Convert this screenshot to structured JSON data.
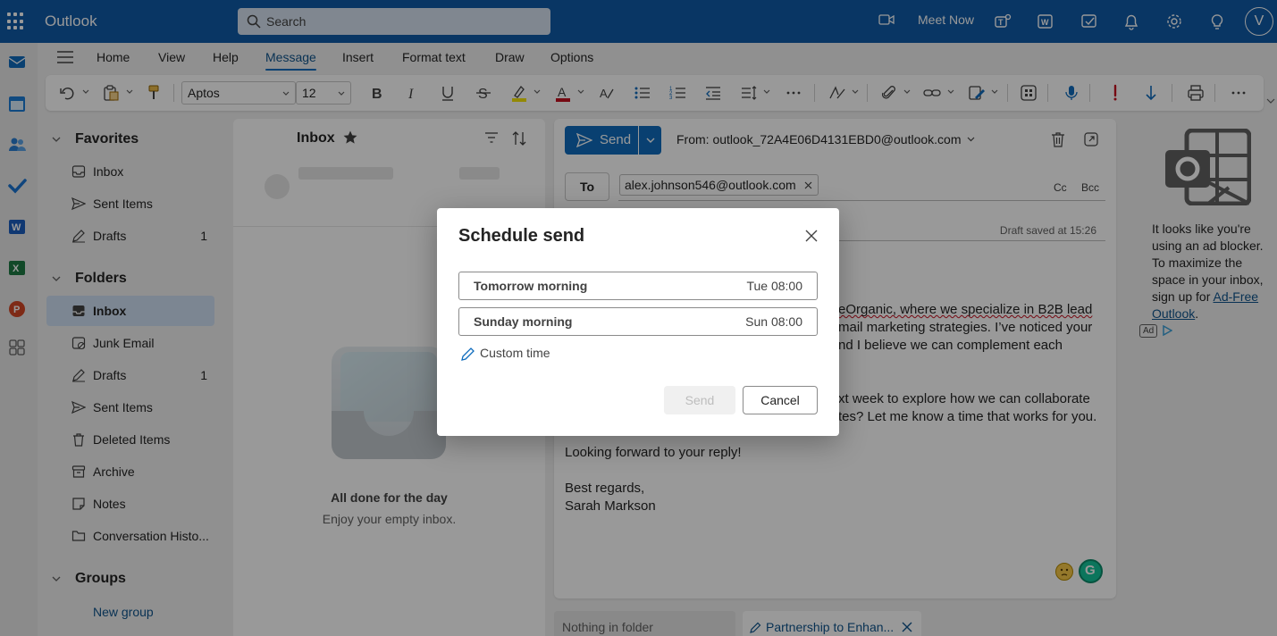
{
  "topbar": {
    "app_title": "Outlook",
    "search_placeholder": "Search",
    "meet_now": "Meet Now",
    "avatar_initial": "V"
  },
  "ribbon": {
    "tabs": [
      "Home",
      "View",
      "Help",
      "Message",
      "Insert",
      "Format text",
      "Draw",
      "Options"
    ],
    "active_tab": "Message",
    "font_name": "Aptos",
    "font_size": "12"
  },
  "folders": {
    "favorites_label": "Favorites",
    "favorites": [
      {
        "label": "Inbox",
        "count": "",
        "icon": "inbox-icon"
      },
      {
        "label": "Sent Items",
        "count": "",
        "icon": "send-icon"
      },
      {
        "label": "Drafts",
        "count": "1",
        "icon": "pencil-icon"
      }
    ],
    "folders_label": "Folders",
    "items": [
      {
        "label": "Inbox",
        "count": "",
        "icon": "inbox-icon"
      },
      {
        "label": "Junk Email",
        "count": "",
        "icon": "junk-icon"
      },
      {
        "label": "Drafts",
        "count": "1",
        "icon": "pencil-icon"
      },
      {
        "label": "Sent Items",
        "count": "",
        "icon": "send-icon"
      },
      {
        "label": "Deleted Items",
        "count": "",
        "icon": "trash-icon"
      },
      {
        "label": "Archive",
        "count": "",
        "icon": "archive-icon"
      },
      {
        "label": "Notes",
        "count": "",
        "icon": "note-icon"
      },
      {
        "label": "Conversation Histo...",
        "count": "",
        "icon": "folder-icon"
      }
    ],
    "groups_label": "Groups",
    "new_group": "New group"
  },
  "message_list": {
    "title": "Inbox",
    "empty_title": "All done for the day",
    "empty_sub": "Enjoy your empty inbox."
  },
  "compose": {
    "send_label": "Send",
    "from": "From: outlook_72A4E06D4131EBD0@outlook.com",
    "to_label": "To",
    "recipient": "alex.johnson546@outlook.com",
    "cc": "Cc",
    "bcc": "Bcc",
    "draft_saved": "Draft saved at 15:26",
    "body_lines": [
      "eOrganic, where we specialize in B2B lead",
      "mail marketing strategies. I’ve noticed your",
      "nd I believe we can complement each",
      "xt week to explore how we can collaborate",
      "tes? Let me know a time that works for you.",
      "Looking forward to your reply!",
      "Best regards,",
      "Sarah Markson"
    ]
  },
  "bottom_tabs": {
    "tab1": "Nothing in folder",
    "tab2": "Partnership to Enhan..."
  },
  "ad": {
    "text": "It looks like you're using an ad blocker. To maximize the space in your inbox, sign up for ",
    "link": "Ad-Free Outlook",
    "period": ".",
    "badge": "Ad"
  },
  "dialog": {
    "title": "Schedule send",
    "options": [
      {
        "label": "Tomorrow morning",
        "time": "Tue 08:00"
      },
      {
        "label": "Sunday morning",
        "time": "Sun 08:00"
      }
    ],
    "custom_time": "Custom time",
    "send": "Send",
    "cancel": "Cancel"
  },
  "colors": {
    "brand": "#0f5aa7",
    "accent": "#0f6cbd"
  }
}
